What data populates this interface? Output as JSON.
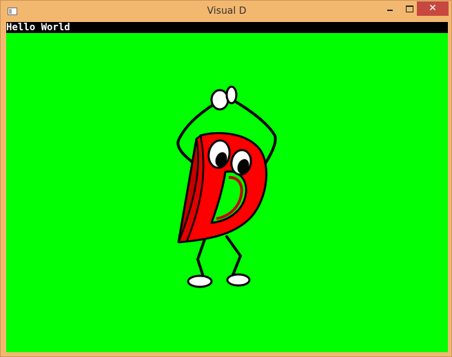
{
  "window": {
    "title": "Visual D",
    "controls": {
      "minimize": "",
      "maximize": "",
      "close": "✕"
    }
  },
  "canvas": {
    "console_text": "Hello World",
    "background_color": "#00ff00"
  },
  "icons": [
    "app-icon",
    "minimize-icon",
    "maximize-icon",
    "close-icon",
    "d-mascot-icon"
  ]
}
